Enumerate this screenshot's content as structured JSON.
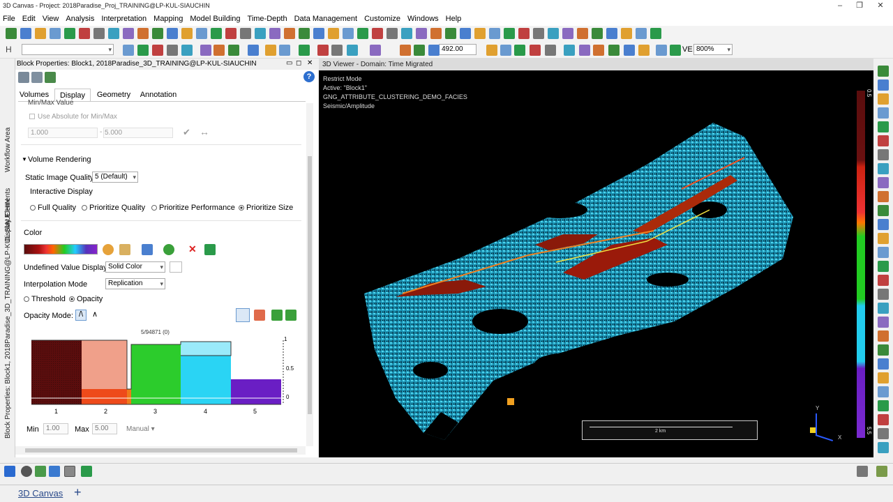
{
  "window": {
    "title": "3D Canvas - Project: 2018Paradise_Proj_TRAINING@LP-KUL-SIAUCHIN"
  },
  "menu": [
    "File",
    "Edit",
    "View",
    "Analysis",
    "Interpretation",
    "Mapping",
    "Model Building",
    "Time-Depth",
    "Data Management",
    "Customize",
    "Windows",
    "Help"
  ],
  "toolbar": {
    "slice_value": "492.00",
    "ve_label": "VE",
    "ve_value": "800%",
    "h_label": "H"
  },
  "sidebar_tabs": [
    "Block Properties: Block1, 2018Paradise_3D_TRAINING@LP-KUL-SIAUCHIN",
    "Display Elements",
    "Workflow Area"
  ],
  "panel": {
    "title": "Block Properties: Block1, 2018Paradise_3D_TRAINING@LP-KUL-SIAUCHIN",
    "tabs": [
      "Volumes",
      "Display",
      "Geometry",
      "Annotation"
    ],
    "minmax_header": "Min/Max Value",
    "use_absolute": "Use Absolute for Min/Max",
    "min_value": "1.000",
    "max_value": "5.000",
    "volume_rendering": "Volume Rendering",
    "static_quality_label": "Static Image Quality",
    "static_quality_value": "5 (Default)",
    "interactive_display": "Interactive Display",
    "quality_options": [
      "Full Quality",
      "Prioritize Quality",
      "Prioritize Performance",
      "Prioritize Size"
    ],
    "color_label": "Color",
    "undefined_label": "Undefined Value Display",
    "undefined_value": "Solid Color",
    "interp_label": "Interpolation Mode",
    "interp_value": "Replication",
    "threshold": "Threshold",
    "opacity": "Opacity",
    "opacity_mode": "Opacity Mode:",
    "histogram_count": "5/94871 (0)",
    "hist_x_ticks": [
      "1",
      "2",
      "3",
      "4",
      "5"
    ],
    "hist_y_ticks": [
      "1",
      "0.5",
      "0"
    ],
    "min_label": "Min",
    "min_val": "1.00",
    "max_label": "Max",
    "max_val": "5.00",
    "manual": "Manual"
  },
  "viewer": {
    "title": "3D Viewer - Domain: Time Migrated",
    "info": [
      "Restrict Mode",
      "Active: \"Block1\"",
      "GNG_ATTRIBUTE_CLUSTERING_DEMO_FACIES",
      "Seismic/Amplitude"
    ],
    "scale_label": "2 km",
    "colorbar_top": "0.5",
    "colorbar_bottom": "5.5",
    "axis_y": "Y",
    "axis_x": "X"
  },
  "bottom": {
    "canvas_tab": "3D Canvas",
    "add": "+"
  }
}
